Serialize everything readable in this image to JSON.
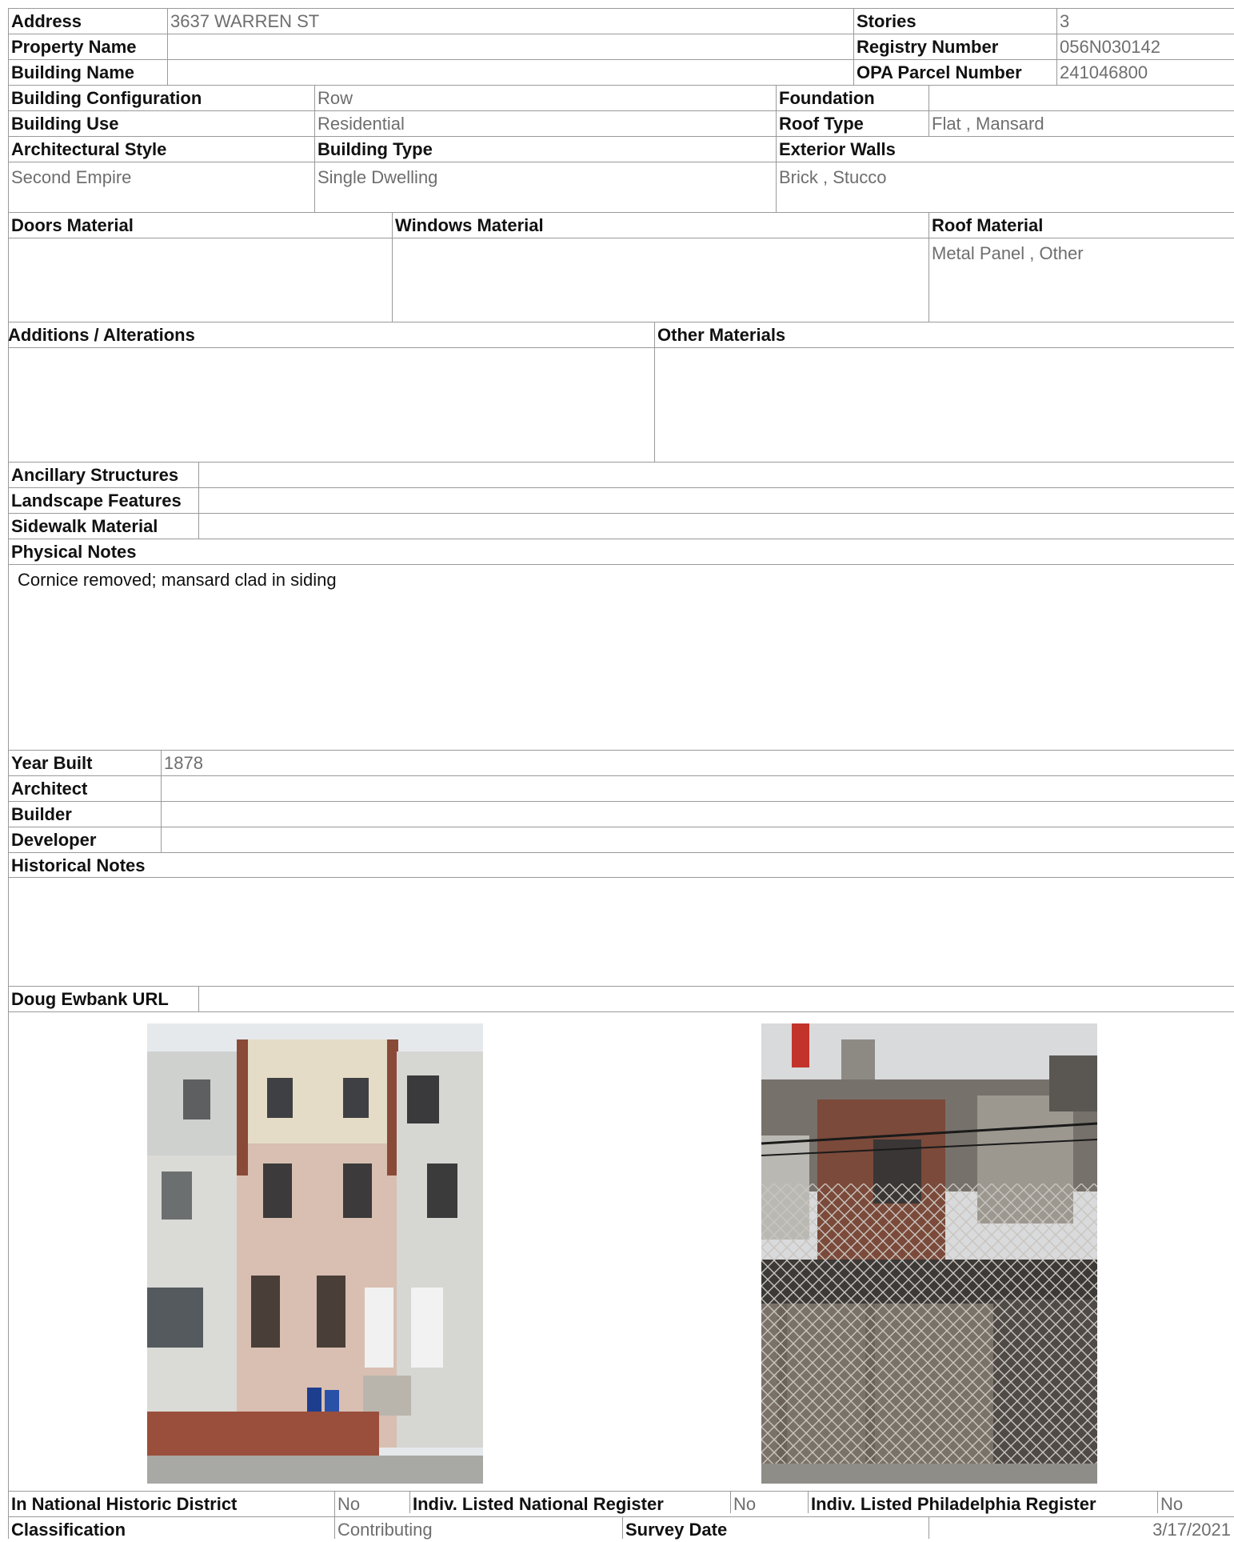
{
  "header": {
    "address_label": "Address",
    "address": "3637 WARREN ST",
    "stories_label": "Stories",
    "stories": "3",
    "property_name_label": "Property Name",
    "property_name": "",
    "registry_label": "Registry Number",
    "registry": "056N030142",
    "building_name_label": "Building Name",
    "building_name": "",
    "opa_label": "OPA Parcel Number",
    "opa": "241046800"
  },
  "building": {
    "configuration_label": "Building Configuration",
    "configuration": "Row",
    "foundation_label": "Foundation",
    "foundation": "",
    "use_label": "Building Use",
    "use": "Residential",
    "roof_type_label": "Roof Type",
    "roof_type": "Flat , Mansard",
    "style_label": "Architectural Style",
    "style": "Second Empire",
    "type_label": "Building Type",
    "type": "Single Dwelling",
    "walls_label": "Exterior Walls",
    "walls": "Brick , Stucco"
  },
  "materials": {
    "doors_label": "Doors Material",
    "doors": "",
    "windows_label": "Windows Material",
    "windows": "",
    "roof_label": "Roof Material",
    "roof": "Metal Panel , Other",
    "additions_label": "Additions / Alterations",
    "additions": "",
    "other_label": "Other Materials",
    "other": ""
  },
  "site": {
    "ancillary_label": "Ancillary Structures",
    "ancillary": "",
    "landscape_label": "Landscape Features",
    "landscape": "",
    "sidewalk_label": "Sidewalk Material",
    "sidewalk": "",
    "physical_notes_label": "Physical Notes",
    "physical_notes": "Cornice removed; mansard clad in siding"
  },
  "history": {
    "year_label": "Year Built",
    "year": "1878",
    "architect_label": "Architect",
    "architect": "",
    "builder_label": "Builder",
    "builder": "",
    "developer_label": "Developer",
    "developer": "",
    "notes_label": "Historical Notes",
    "notes": "",
    "url_label": "Doug Ewbank URL",
    "url": ""
  },
  "footer": {
    "district_label": "In National Historic District",
    "district": "No",
    "national_label": "Indiv. Listed National Register",
    "national": "No",
    "phila_label": "Indiv. Listed Philadelphia Register",
    "phila": "No",
    "classification_label": "Classification",
    "classification": "Contributing",
    "survey_label": "Survey Date",
    "survey": "3/17/2021"
  },
  "colors": {
    "label_text": "#111111",
    "value_text": "#6e6e6e",
    "rule": "#9a9a9a",
    "stucco": "#d8bfb2",
    "siding": "#e4dcc6",
    "brick": "#8a4a38",
    "fence": "#7a7168"
  }
}
